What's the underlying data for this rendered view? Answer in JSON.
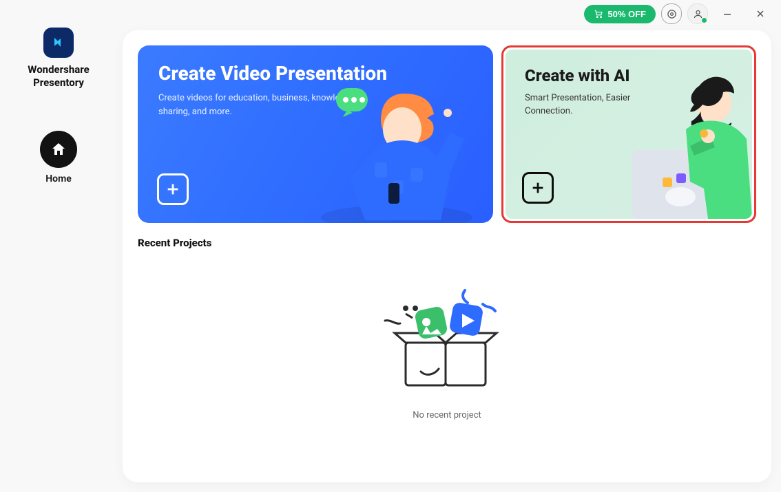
{
  "brand": {
    "line1": "Wondershare",
    "line2": "Presentory"
  },
  "offer_label": "50% OFF",
  "nav": {
    "home_label": "Home"
  },
  "cards": {
    "video": {
      "title": "Create Video Presentation",
      "desc": "Create videos for education, business, knowledge sharing, and more."
    },
    "ai": {
      "title": "Create with AI",
      "desc": "Smart Presentation, Easier Connection."
    }
  },
  "recent": {
    "heading": "Recent Projects",
    "empty_text": "No recent project"
  }
}
